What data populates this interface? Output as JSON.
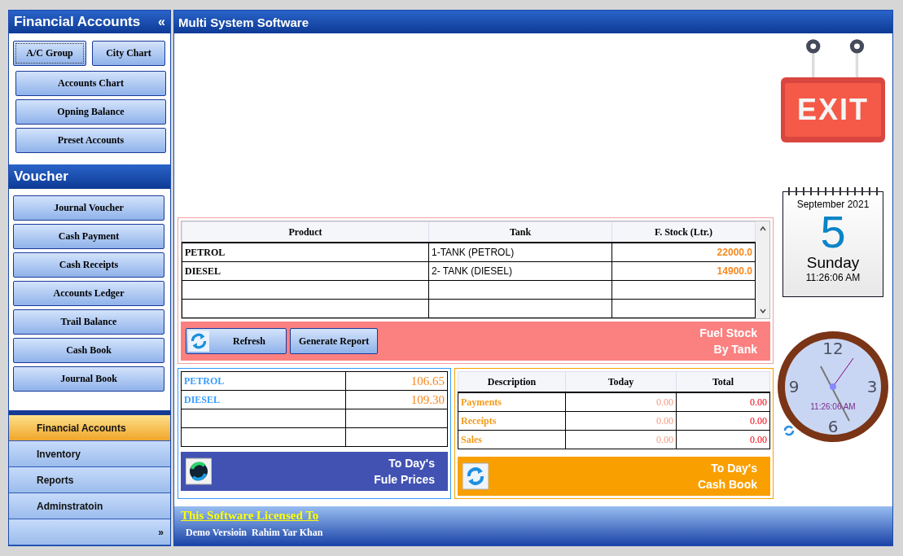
{
  "sidebar": {
    "title": "Financial Accounts",
    "collapse_glyph": "«",
    "top_buttons": [
      {
        "label": "A/C Group",
        "focused": true
      },
      {
        "label": "City Chart",
        "focused": false
      }
    ],
    "buttons": [
      "Accounts Chart",
      "Opning Balance",
      "Preset Accounts"
    ],
    "voucher_title": "Voucher",
    "voucher_buttons": [
      "Journal Voucher",
      "Cash Payment",
      "Cash Receipts",
      "Accounts Ledger",
      "Trail Balance",
      "Cash Book",
      "Journal Book"
    ],
    "nav": [
      {
        "label": "Financial Accounts",
        "selected": true
      },
      {
        "label": "Inventory",
        "selected": false
      },
      {
        "label": "Reports",
        "selected": false
      },
      {
        "label": "Adminstratoin",
        "selected": false
      }
    ],
    "more_glyph": "»"
  },
  "window": {
    "title": "Multi System Software"
  },
  "exit": {
    "label": "EXIT"
  },
  "calendar": {
    "month": "September 2021",
    "day": "5",
    "weekday": "Sunday",
    "time": "11:26:06 AM"
  },
  "clock": {
    "numerals": [
      "12",
      "3",
      "6",
      "9"
    ],
    "time": "11:26:06 AM"
  },
  "fuel_stock": {
    "columns": [
      "Product",
      "Tank",
      "F. Stock (Ltr.)"
    ],
    "rows": [
      [
        "PETROL",
        "1-TANK (PETROL)",
        "22000.0"
      ],
      [
        "DIESEL",
        "2- TANK (DIESEL)",
        "14900.0"
      ]
    ],
    "buttons": [
      "Refresh",
      "Generate Report"
    ],
    "caption": [
      "Fuel Stock",
      "By Tank"
    ]
  },
  "fuel_prices": {
    "rows": [
      [
        "PETROL",
        "106.65"
      ],
      [
        "DIESEL",
        "109.30"
      ]
    ],
    "caption": [
      "To Day's",
      "Fule Prices"
    ]
  },
  "cash_book": {
    "columns": [
      "Description",
      "Today",
      "Total"
    ],
    "rows": [
      [
        "Payments",
        "0.00",
        "0.00"
      ],
      [
        "Receipts",
        "0.00",
        "0.00"
      ],
      [
        "Sales",
        "0.00",
        "0.00"
      ]
    ],
    "caption": [
      "To Day's",
      "Cash Book"
    ]
  },
  "license": {
    "title": "This Software Licensed To",
    "text": "Demo Versioin  Rahim Yar Khan"
  }
}
